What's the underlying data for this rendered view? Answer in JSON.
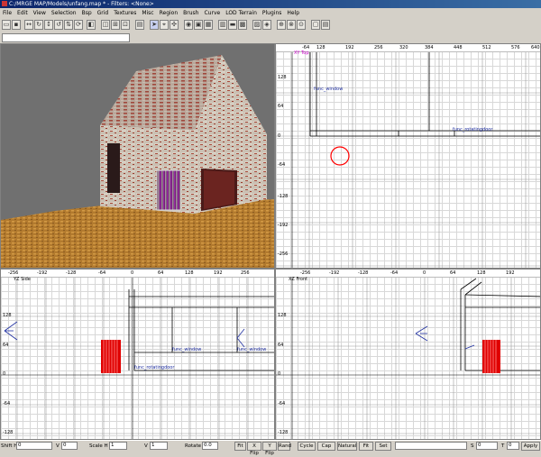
{
  "window": {
    "title": "C:/MRGE MAP/Models/unfang.map * - Filters: <None>"
  },
  "menu": [
    "File",
    "Edit",
    "View",
    "Selection",
    "Bsp",
    "Grid",
    "Textures",
    "Misc",
    "Region",
    "Brush",
    "Curve",
    "LOD Terrain",
    "Plugins",
    "Help"
  ],
  "command_input": {
    "value": ""
  },
  "viewports": {
    "xy": {
      "label": "XY Top",
      "xticks": [
        "-64",
        "128",
        "192",
        "256",
        "320",
        "384",
        "448",
        "512",
        "576",
        "640"
      ],
      "yticks": [
        "128",
        "64",
        "0",
        "-64",
        "-128",
        "-192",
        "-256"
      ],
      "entities": [
        "func_window",
        "func_rotatingdoor"
      ]
    },
    "yz": {
      "label": "YZ Side",
      "xticks": [
        "-256",
        "-192",
        "-128",
        "-64",
        "0",
        "64",
        "128",
        "192",
        "256"
      ],
      "yticks": [
        "128",
        "64",
        "0",
        "-64",
        "-128"
      ],
      "entities": [
        "func_window",
        "func_window",
        "func_rotatingdoor"
      ]
    },
    "xz": {
      "label": "XZ Front",
      "xticks": [
        "-256",
        "-192",
        "-128",
        "-64",
        "0",
        "64",
        "128",
        "192"
      ],
      "yticks": [
        "128",
        "64",
        "0",
        "-64",
        "-128"
      ]
    }
  },
  "colors": {
    "grid_major": "#808080",
    "grid_minor": "#d8d8d8",
    "camera": "#ff0000",
    "brush": "#000000",
    "selected": "#cc0000",
    "entity_label": "#2030a0",
    "viewport_label": "#cc00cc"
  },
  "status": {
    "shift_h_label": "Shift H",
    "shift_h": "0",
    "v_label": "V",
    "shift_v": "0",
    "scale_h_label": "Scale H",
    "scale_h": "1",
    "scale_v_label": "V",
    "scale_v": "1",
    "rotate_label": "Rotate",
    "rotate": "0.0",
    "fit": "Fit",
    "xflip": "X Flip",
    "yflip": "Y Flip",
    "rand": "Rand",
    "cycle": "Cycle",
    "cap": "Cap",
    "natural": "Natural",
    "fit2": "Fit",
    "set": "Set",
    "s_label": "S",
    "s_value": "0",
    "t_label": "T",
    "t_value": "0",
    "apply": "Apply"
  }
}
